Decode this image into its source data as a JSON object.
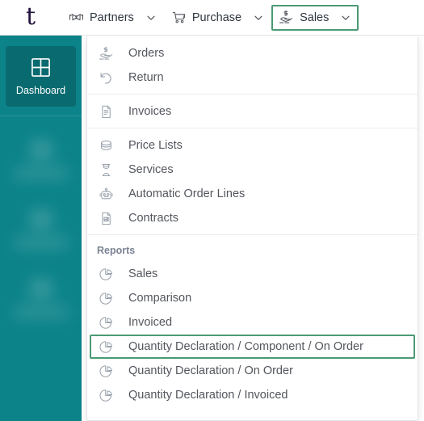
{
  "brand": {
    "logo_text": "t"
  },
  "topnav": {
    "items": [
      {
        "label": "Partners",
        "icon": "handshake-icon",
        "caret": "chevron-down-icon",
        "active": false
      },
      {
        "label": "Purchase",
        "icon": "shopping-cart-icon",
        "caret": "chevron-down-icon",
        "active": false
      },
      {
        "label": "Sales",
        "icon": "hand-dollar-icon",
        "caret": "chevron-down-icon",
        "active": true
      }
    ]
  },
  "sidebar": {
    "active_item": {
      "label": "Dashboard",
      "icon": "grid-icon"
    },
    "placeholder_count": 3
  },
  "dropdown": {
    "groups": [
      {
        "title": null,
        "items": [
          {
            "label": "Orders",
            "icon": "hand-dollar-icon",
            "highlighted": false
          },
          {
            "label": "Return",
            "icon": "undo-arrow-icon",
            "highlighted": false
          }
        ]
      },
      {
        "title": null,
        "items": [
          {
            "label": "Invoices",
            "icon": "document-lines-icon",
            "highlighted": false
          }
        ]
      },
      {
        "title": null,
        "items": [
          {
            "label": "Price Lists",
            "icon": "stacked-coins-icon",
            "highlighted": false
          },
          {
            "label": "Services",
            "icon": "hourglass-icon",
            "highlighted": false
          },
          {
            "label": "Automatic Order Lines",
            "icon": "robot-icon",
            "highlighted": false
          },
          {
            "label": "Contracts",
            "icon": "document-image-icon",
            "highlighted": false
          }
        ]
      },
      {
        "title": "Reports",
        "items": [
          {
            "label": "Sales",
            "icon": "pie-chart-icon",
            "highlighted": false
          },
          {
            "label": "Comparison",
            "icon": "pie-chart-icon",
            "highlighted": false
          },
          {
            "label": "Invoiced",
            "icon": "pie-chart-icon",
            "highlighted": false
          },
          {
            "label": "Quantity Declaration / Component / On Order",
            "icon": "pie-chart-icon",
            "highlighted": true
          },
          {
            "label": "Quantity Declaration / On Order",
            "icon": "pie-chart-icon",
            "highlighted": false
          },
          {
            "label": "Quantity Declaration / Invoiced",
            "icon": "pie-chart-icon",
            "highlighted": false
          }
        ]
      }
    ]
  },
  "colors": {
    "sidebar_bg": "#0b8389",
    "sidebar_tile_bg": "#096b70",
    "highlight_border": "#4a9a72",
    "brand_text": "#25133f",
    "menu_text": "#53565d",
    "group_title": "#7b8494",
    "icon_stroke": "#9aa2ad"
  }
}
